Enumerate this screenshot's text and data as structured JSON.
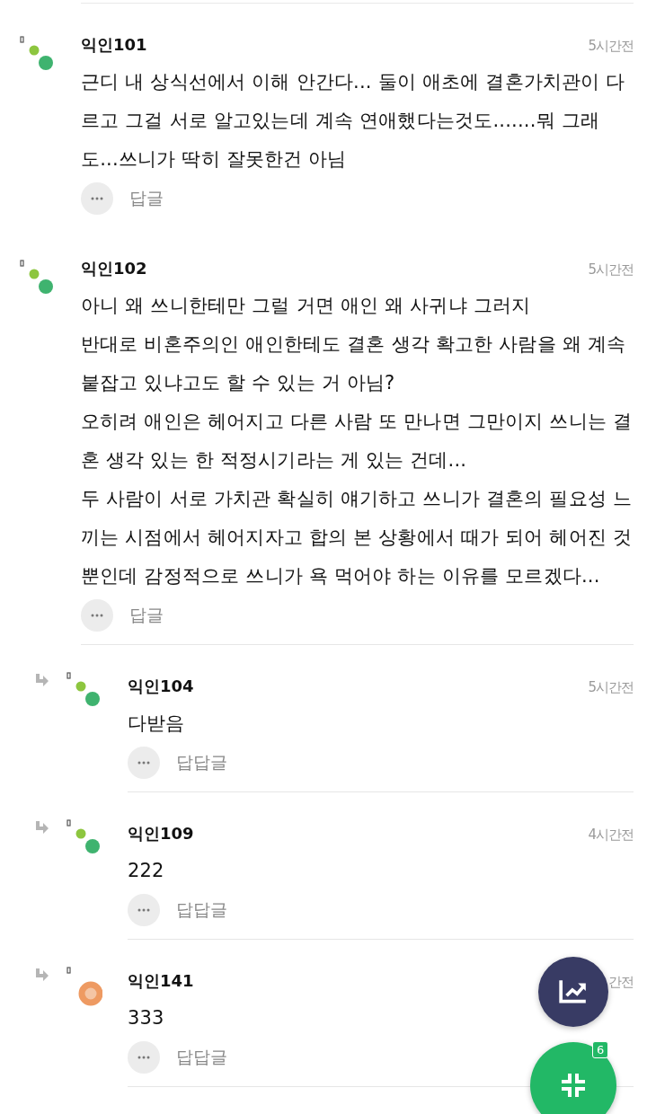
{
  "comments": [
    {
      "kind": "comment",
      "avatar": {
        "kind": "dots"
      },
      "name": "익인101",
      "time": "5시간전",
      "paragraphs": [
        "근디 내 상식선에서 이해 안간다... 둘이 애초에 결혼가치관이 다르고 그걸 서로 알고있는데 계속 연애했다는것도.......뭐 그래도...쓰니가 딱히 잘못한건 아님"
      ],
      "reply_label": "답글",
      "divider_below": false
    },
    {
      "kind": "comment",
      "avatar": {
        "kind": "dots"
      },
      "name": "익인102",
      "time": "5시간전",
      "paragraphs": [
        "아니 왜 쓰니한테만 그럴 거면 애인 왜 사귀냐 그러지",
        "반대로 비혼주의인 애인한테도 결혼 생각 확고한 사람을 왜 계속 붙잡고 있냐고도 할 수 있는 거 아님?",
        "오히려 애인은 헤어지고 다른 사람 또 만나면 그만이지 쓰니는 결혼 생각 있는 한 적정시기라는 게 있는 건데...",
        "두 사람이 서로 가치관 확실히 얘기하고 쓰니가 결혼의 필요성 느끼는 시점에서 헤어지자고 합의 본 상황에서 때가 되어 헤어진 것뿐인데 감정적으로 쓰니가 욕 먹어야 하는 이유를 모르겠다..."
      ],
      "reply_label": "답글",
      "divider_below": true
    },
    {
      "kind": "reply",
      "avatar": {
        "kind": "dots"
      },
      "name": "익인104",
      "time": "5시간전",
      "paragraphs": [
        "다받음"
      ],
      "reply_label": "답답글",
      "divider_below": true
    },
    {
      "kind": "reply",
      "avatar": {
        "kind": "dots"
      },
      "name": "익인109",
      "time": "4시간전",
      "paragraphs": [
        "222"
      ],
      "reply_label": "답답글",
      "divider_below": true
    },
    {
      "kind": "reply",
      "avatar": {
        "kind": "ring"
      },
      "name": "익인141",
      "time": "간전",
      "paragraphs": [
        "333"
      ],
      "reply_label": "답답글",
      "divider_below": true
    }
  ],
  "fab_badge": "6"
}
